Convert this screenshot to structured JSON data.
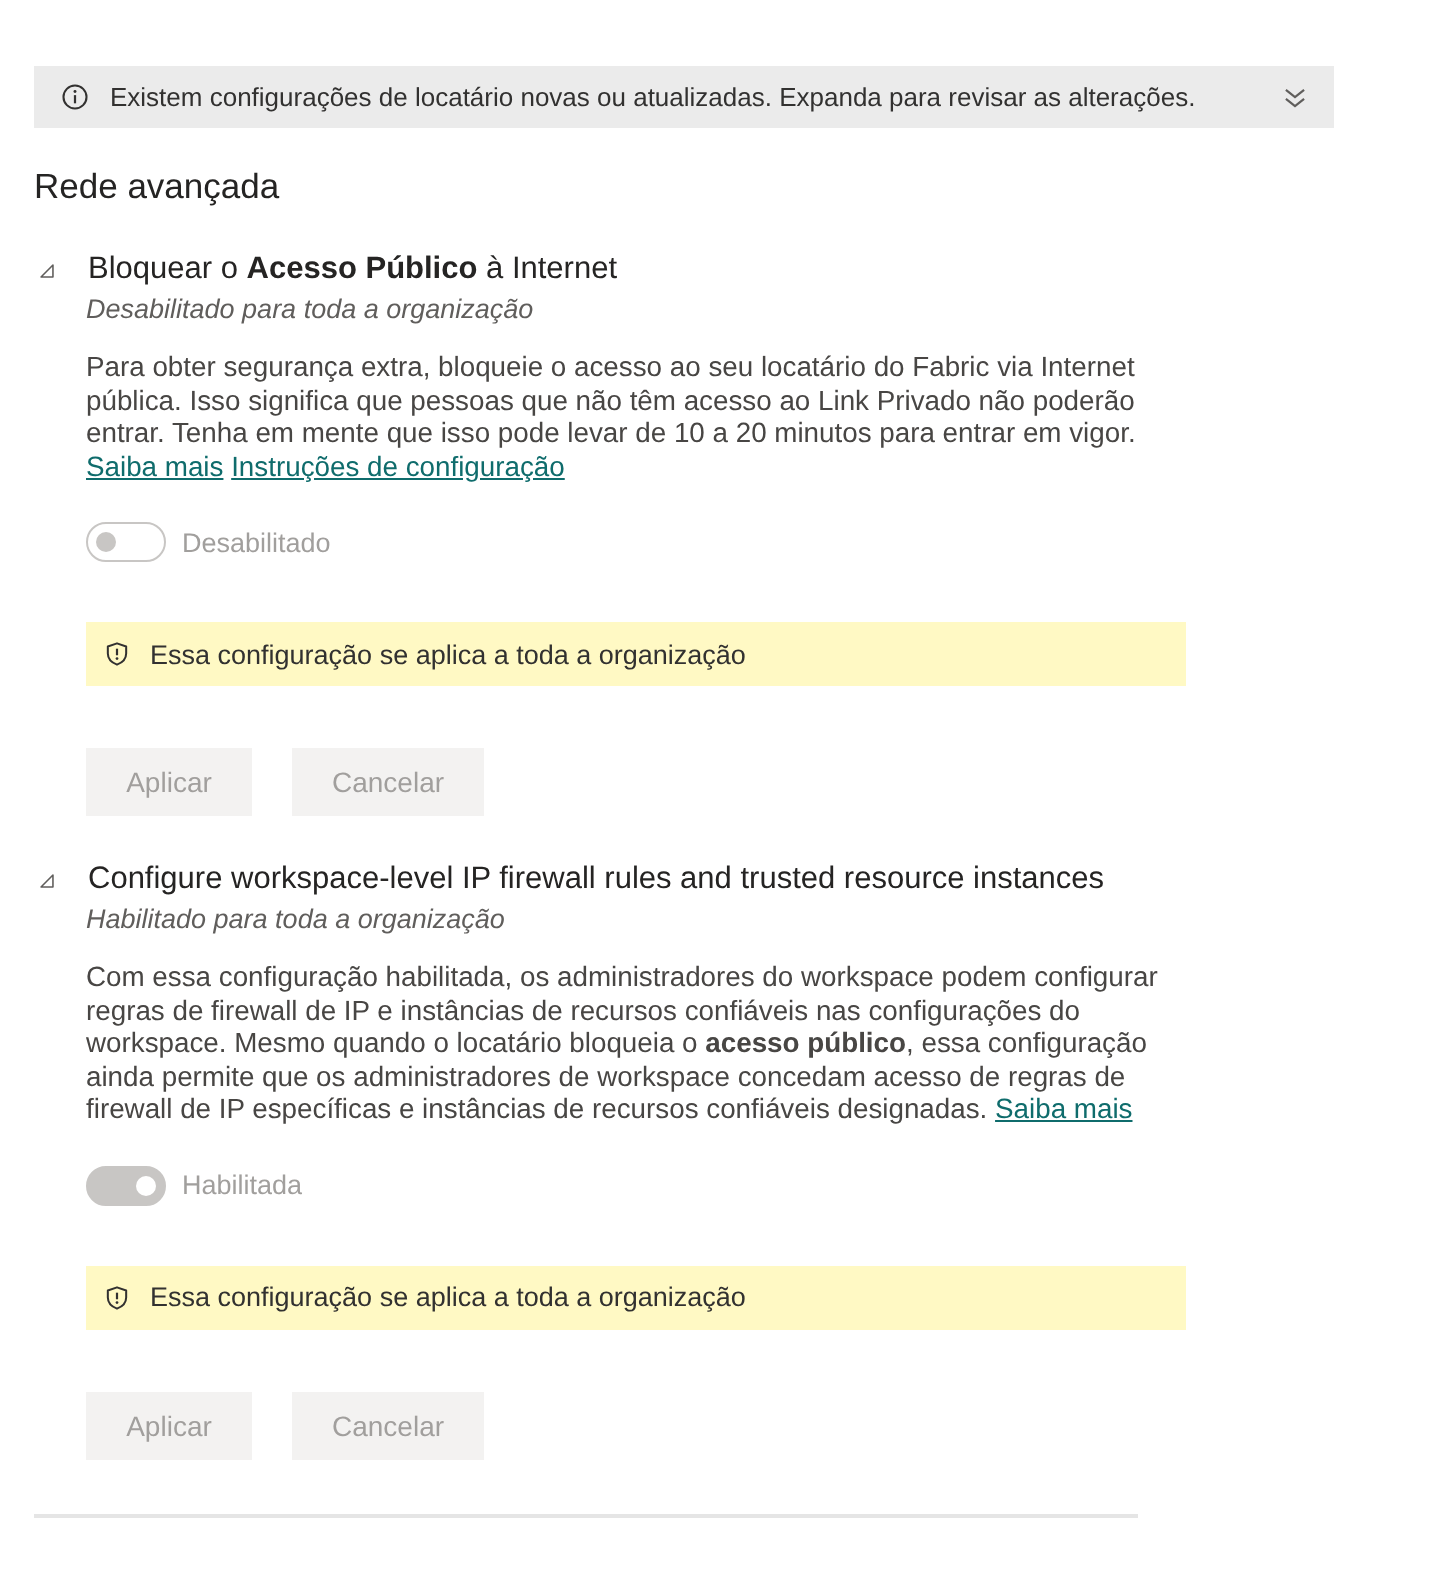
{
  "notification_bar": {
    "text": "Existem configurações de locatário novas ou atualizadas. Expanda para revisar as alterações.",
    "expanded": false
  },
  "heading": "Rede avançada",
  "settings": [
    {
      "title": "Bloquear o **Acesso Público** à Internet",
      "expanded": true,
      "status": "Desabilitado para toda a organização",
      "description": "Para obter segurança extra, bloqueie o acesso ao seu locatário do Fabric via Internet pública. Isso significa que pessoas que não têm acesso ao Link Privado não poderão entrar. Tenha em mente que isso pode levar de 10 a 20 minutos para entrar em vigor.",
      "links": [
        "Saiba mais",
        "Instruções de configuração"
      ],
      "toggle": {
        "label": "Desabilitado",
        "on": false,
        "disabled": true
      },
      "notice": "Essa configuração se aplica a toda a organização",
      "buttons": [
        {
          "label": "Aplicar",
          "disabled": true
        },
        {
          "label": "Cancelar",
          "disabled": true
        }
      ]
    },
    {
      "title": "Configure workspace-level IP firewall rules and trusted resource instances",
      "expanded": true,
      "status": "Habilitado para toda a organização",
      "description": "Com essa configuração habilitada, os administradores do workspace podem configurar regras de firewall de IP e instâncias de recursos confiáveis nas configurações do workspace. Mesmo quando o locatário bloqueia o **acesso público**, essa configuração ainda permite que os administradores de workspace concedam acesso de regras de firewall de IP específicas e instâncias de recursos confiáveis designadas.",
      "links": [
        "Saiba mais"
      ],
      "toggle": {
        "label": "Habilitada",
        "on": true,
        "disabled": true
      },
      "notice": "Essa configuração se aplica a toda a organização",
      "buttons": [
        {
          "label": "Aplicar",
          "disabled": true
        },
        {
          "label": "Cancelar",
          "disabled": true
        }
      ]
    }
  ]
}
